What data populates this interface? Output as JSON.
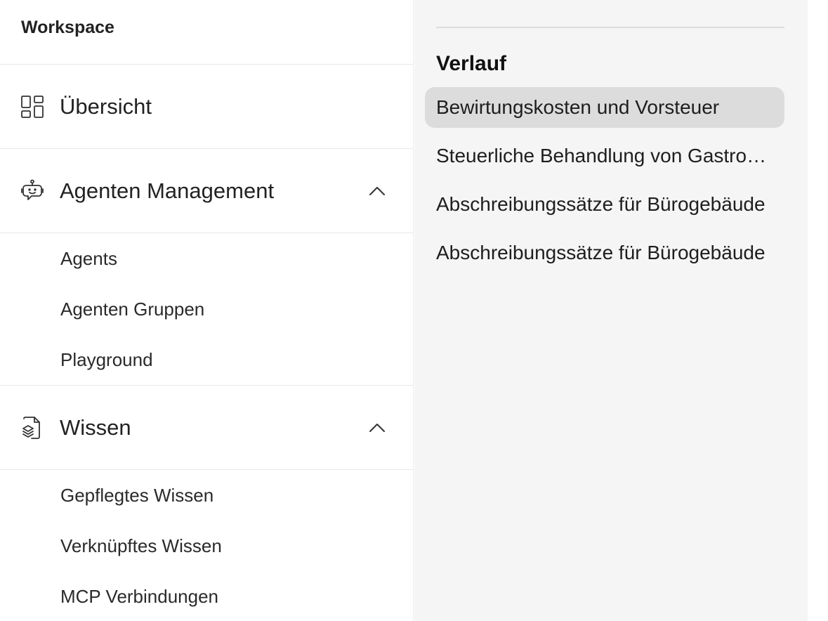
{
  "nav": {
    "header": "Workspace",
    "overview": {
      "label": "Übersicht"
    },
    "agents_section": {
      "label": "Agenten Management",
      "items": [
        "Agents",
        "Agenten Gruppen",
        "Playground"
      ]
    },
    "knowledge_section": {
      "label": "Wissen",
      "items": [
        "Gepflegtes Wissen",
        "Verknüpftes Wissen",
        "MCP Verbindungen"
      ]
    }
  },
  "history": {
    "title": "Verlauf",
    "items": [
      "Bewirtungskosten und Vorsteuer",
      "Steuerliche Behandlung von Gastronomieumsätzen",
      "Abschreibungssätze für Bürogebäude",
      "Abschreibungssätze für Bürogebäude"
    ],
    "active_index": 0
  },
  "icons": {
    "overview": "dashboard-grid-icon",
    "agents": "robot-chat-icon",
    "knowledge": "knowledge-document-icon",
    "collapse": "chevron-up-icon"
  }
}
